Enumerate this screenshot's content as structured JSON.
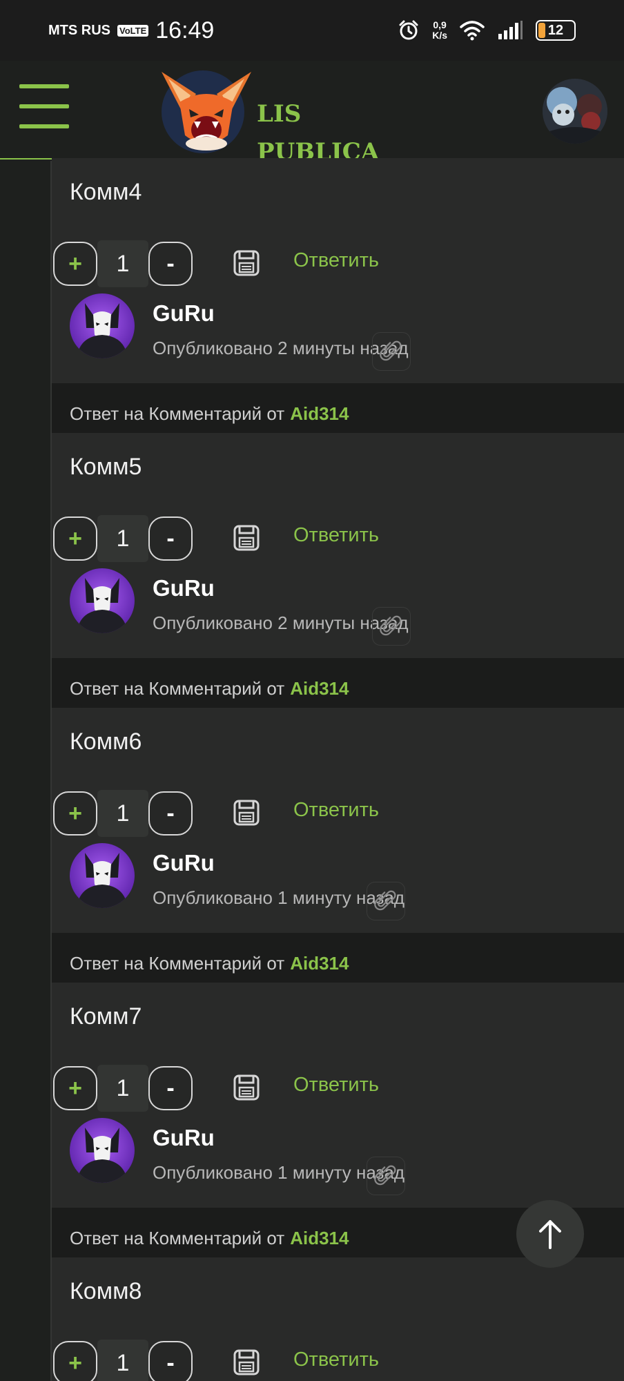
{
  "status_bar": {
    "carrier": "MTS RUS",
    "volte": "VoLTE",
    "time": "16:49",
    "net_speed_value": "0,9",
    "net_speed_unit": "K/s",
    "battery": "12"
  },
  "header": {
    "logo_line1": "LIS",
    "logo_line2": "PUBLICA",
    "accent": "#8bc34a"
  },
  "icons": {
    "menu": "hamburger-icon",
    "save": "floppy-disk-icon",
    "attach": "paperclip-icon",
    "scroll_top": "arrow-up-icon"
  },
  "comments": [
    {
      "text": "Комм4",
      "plus": "+",
      "count": "1",
      "minus": "-",
      "reply": "Ответить",
      "author": "GuRu",
      "published": "Опубликовано 2 минуты назад",
      "reply_prefix": "Ответ на Комментарий от",
      "reply_author": "Aid314"
    },
    {
      "text": "Комм5",
      "plus": "+",
      "count": "1",
      "minus": "-",
      "reply": "Ответить",
      "author": "GuRu",
      "published": "Опубликовано 2 минуты назад",
      "reply_prefix": "Ответ на Комментарий от",
      "reply_author": "Aid314"
    },
    {
      "text": "Комм6",
      "plus": "+",
      "count": "1",
      "minus": "-",
      "reply": "Ответить",
      "author": "GuRu",
      "published": "Опубликовано 1 минуту назад",
      "reply_prefix": "Ответ на Комментарий от",
      "reply_author": "Aid314"
    },
    {
      "text": "Комм7",
      "plus": "+",
      "count": "1",
      "minus": "-",
      "reply": "Ответить",
      "author": "GuRu",
      "published": "Опубликовано 1 минуту назад",
      "reply_prefix": "Ответ на Комментарий от",
      "reply_author": "Aid314"
    },
    {
      "text": "Комм8",
      "plus": "+",
      "count": "1",
      "minus": "-",
      "reply": "Ответить"
    }
  ]
}
